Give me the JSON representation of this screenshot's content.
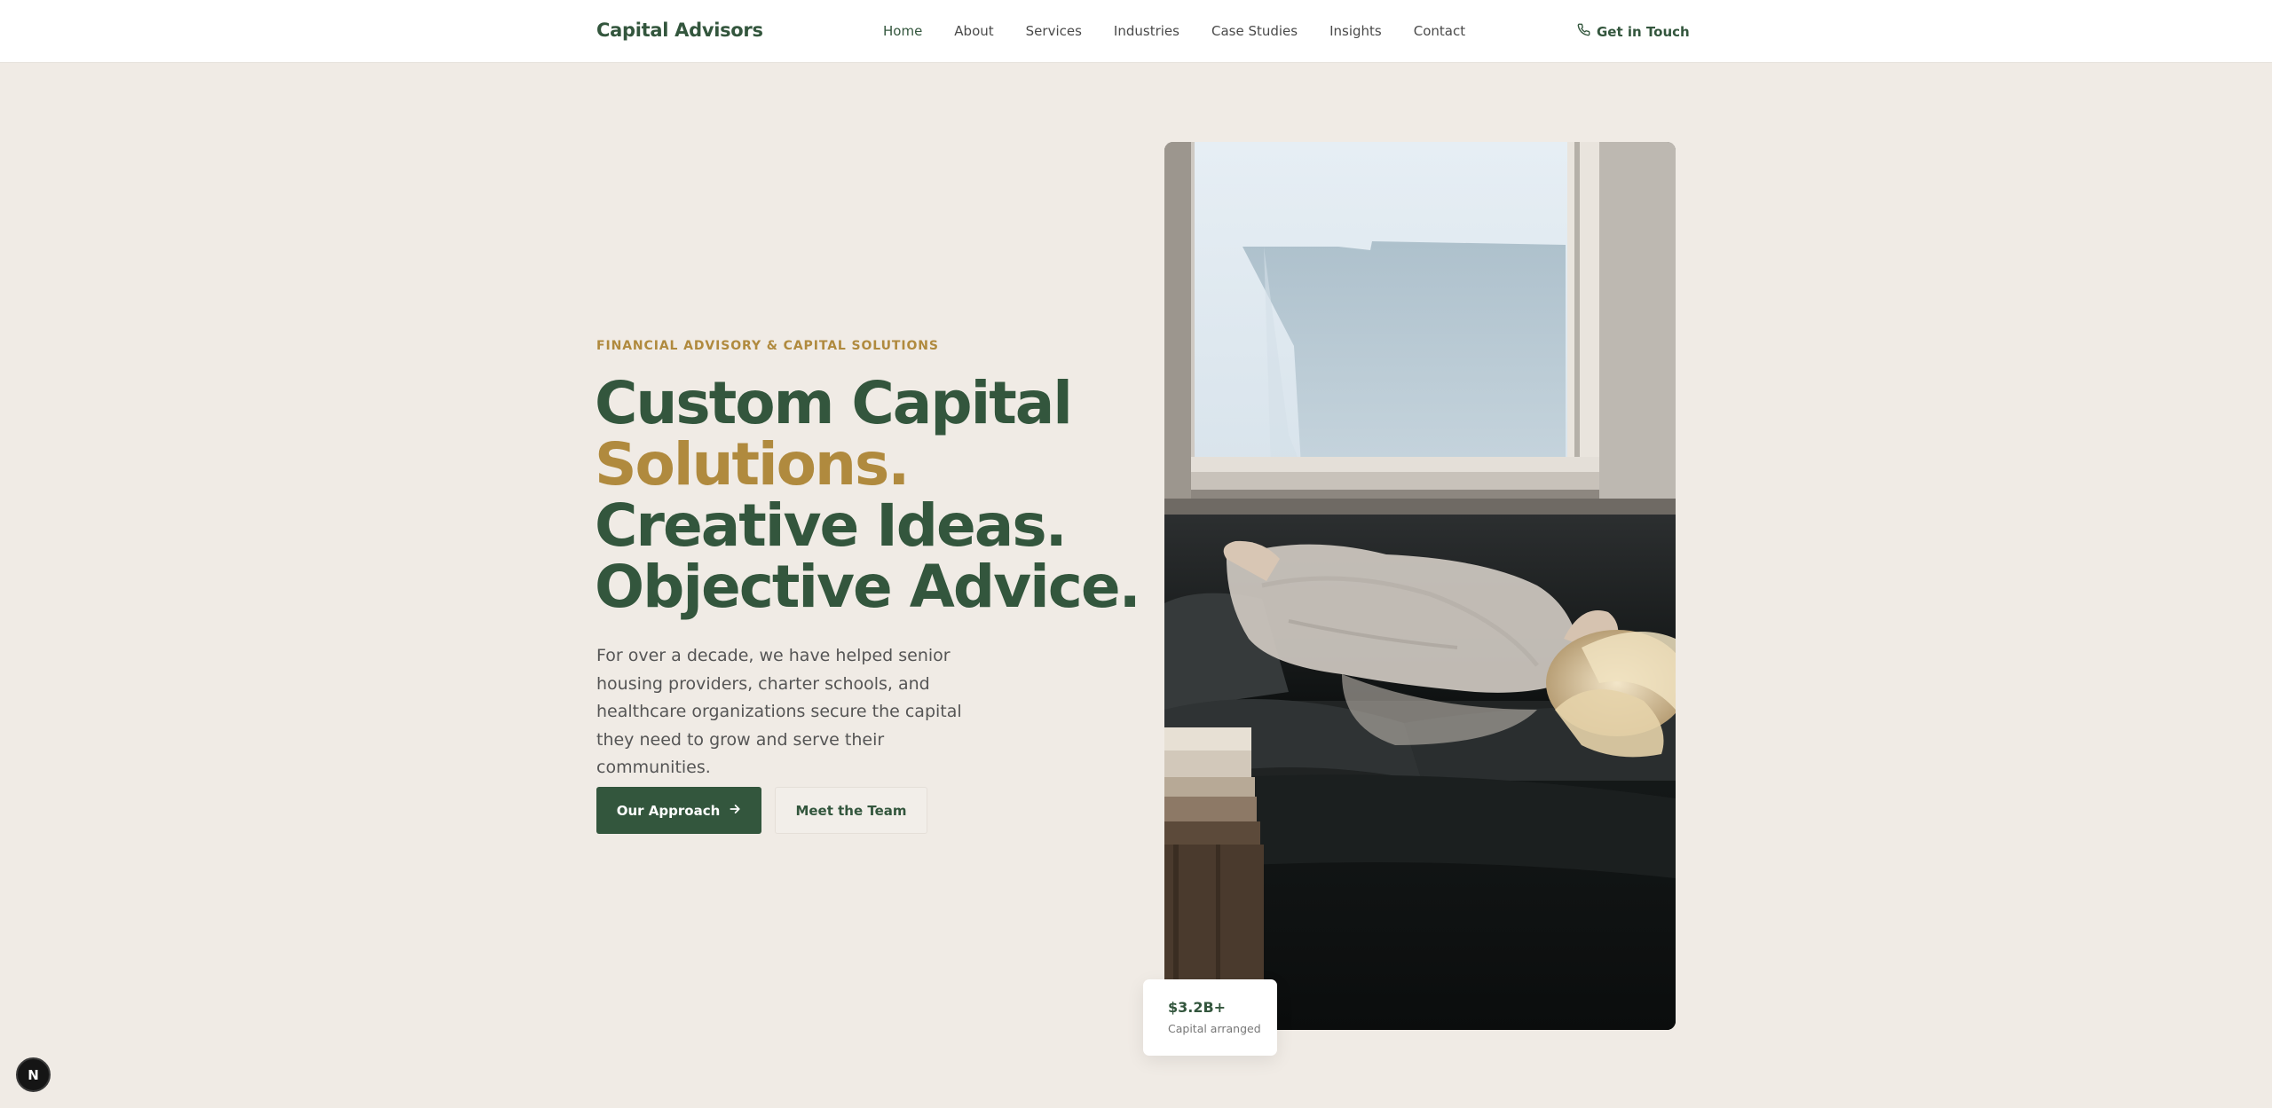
{
  "header": {
    "logo": "Capital Advisors",
    "nav": [
      {
        "label": "Home",
        "active": true
      },
      {
        "label": "About"
      },
      {
        "label": "Services"
      },
      {
        "label": "Industries"
      },
      {
        "label": "Case Studies"
      },
      {
        "label": "Insights"
      },
      {
        "label": "Contact"
      }
    ],
    "cta": {
      "label": "Get in Touch",
      "icon": "phone-icon"
    }
  },
  "hero": {
    "eyebrow": "FINANCIAL ADVISORY & CAPITAL SOLUTIONS",
    "headline": {
      "line1": "Custom Capital",
      "line2": "Solutions.",
      "line3": "Creative Ideas.",
      "line4": "Objective Advice."
    },
    "lede": "For over a decade, we have helped senior housing providers, charter schools, and healthcare organizations secure the capital they need to grow and serve their communities.",
    "primary_button": {
      "label": "Our Approach",
      "icon": "arrow-right-icon"
    },
    "secondary_button": {
      "label": "Meet the Team"
    }
  },
  "stat": {
    "value": "$3.2B+",
    "label": "Capital arranged"
  },
  "dev_badge": {
    "label": "N"
  },
  "colors": {
    "brand_green": "#33563d",
    "accent_gold": "#b08a3e",
    "background": "#f0ebe5"
  }
}
